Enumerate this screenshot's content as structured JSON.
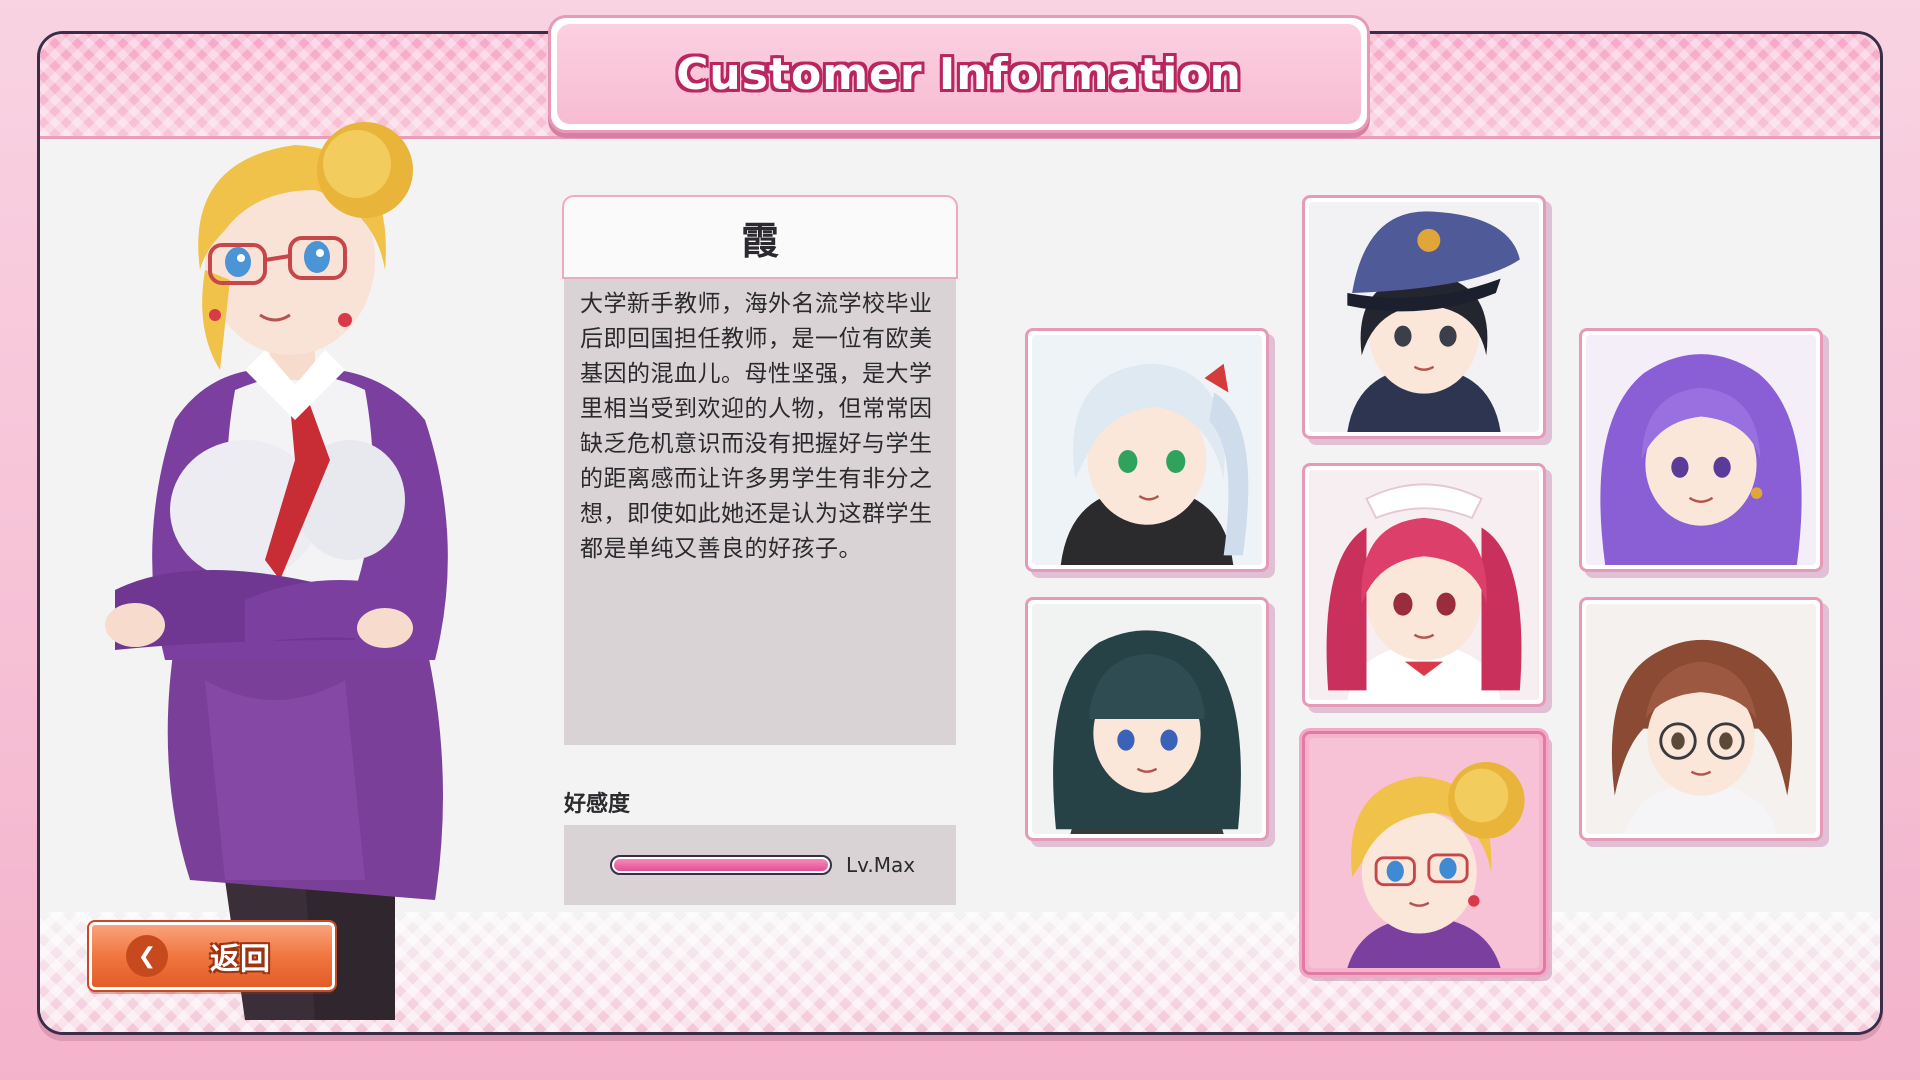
{
  "header": {
    "title": "Customer Information"
  },
  "character": {
    "name": "霞",
    "description": "大学新手教师，海外名流学校毕业后即回国担任教师，是一位有欧美基因的混血儿。母性坚强，是大学里相当受到欢迎的人物，但常常因缺乏危机意识而没有把握好与学生的距离感而让许多男学生有非分之想，即使如此她还是认为这群学生都是单纯又善良的好孩子。",
    "affinity_label": "好感度",
    "affinity_level": "Lv.Max",
    "affinity_fraction": 1.0
  },
  "back_button": {
    "label": "返回",
    "icon": "back-arrow-icon"
  },
  "portraits": [
    {
      "id": "silver-hair",
      "hair": "#dfe9f2",
      "eyes": "#2fa35b",
      "selected": false
    },
    {
      "id": "police-cap",
      "hair": "#23262f",
      "eyes": "#3b3f4a",
      "selected": false
    },
    {
      "id": "purple-hair",
      "hair": "#8a5fd6",
      "eyes": "#5b3b9a",
      "selected": false
    },
    {
      "id": "maid-pink",
      "hair": "#dd3f6b",
      "eyes": "#9a2d3b",
      "selected": false
    },
    {
      "id": "dark-teal",
      "hair": "#264247",
      "eyes": "#3a62b8",
      "selected": false
    },
    {
      "id": "blonde-bun",
      "hair": "#f0c24a",
      "eyes": "#3e8ad3",
      "selected": true
    },
    {
      "id": "brown-glasses",
      "hair": "#8b4a33",
      "eyes": "#5b4a3a",
      "selected": false
    }
  ],
  "colors": {
    "accent": "#e44f94",
    "panel": "#f4f3f4",
    "button": "#f0763f"
  }
}
